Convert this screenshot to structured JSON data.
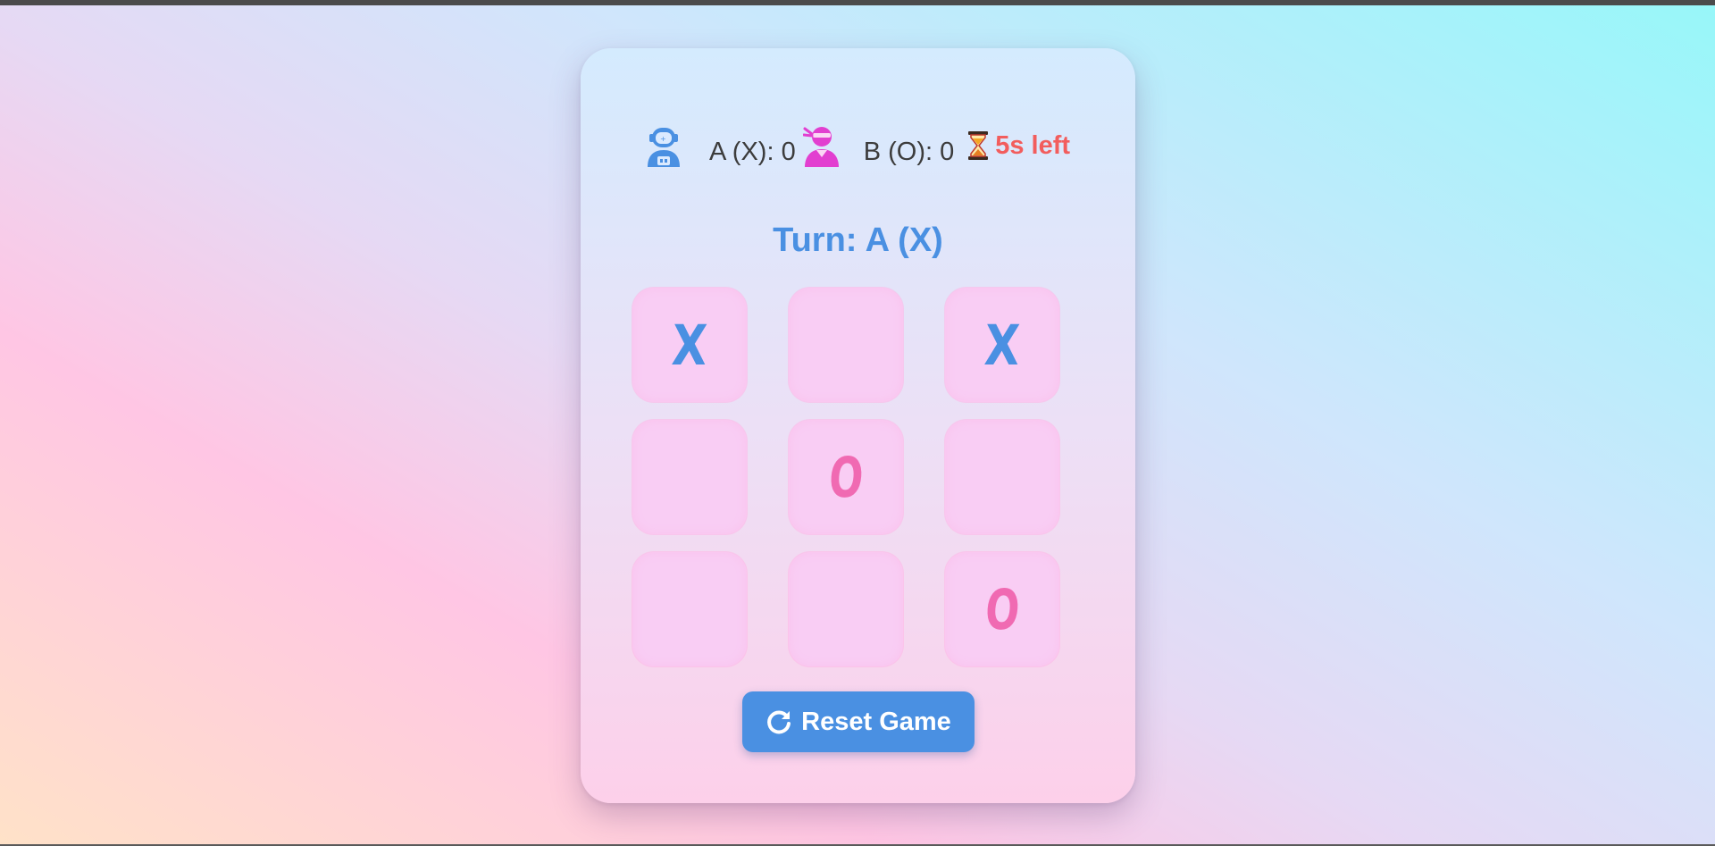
{
  "colors": {
    "accent": "#4a90e2",
    "o_mark": "#f06ab2",
    "timer": "#f25d5d",
    "card_top": "#d4ebfe",
    "card_bottom": "#fdd0ea",
    "cell_bg": "#f9cdf4"
  },
  "scoreboard": {
    "player_a": {
      "icon": "astronaut-icon",
      "label": "A (X): 0"
    },
    "player_b": {
      "icon": "ninja-icon",
      "label": "B (O): 0"
    },
    "timer": {
      "icon": "hourglass-icon",
      "label": "5s left"
    }
  },
  "turn": {
    "label": "Turn: A (X)"
  },
  "board": {
    "cells": [
      "X",
      "",
      "X",
      "",
      "O",
      "",
      "",
      "",
      "O"
    ]
  },
  "reset_button": {
    "icon": "refresh-icon",
    "label": "Reset Game"
  }
}
